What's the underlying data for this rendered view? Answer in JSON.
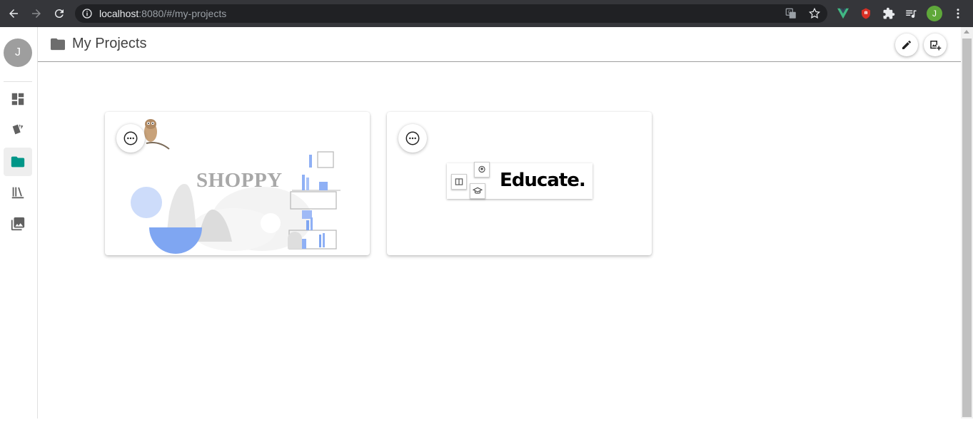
{
  "browser": {
    "url_host": "localhost",
    "url_rest": ":8080/#/my-projects",
    "profile_initial": "J"
  },
  "sidebar": {
    "avatar_initial": "J",
    "items": [
      {
        "icon": "dashboard-icon"
      },
      {
        "icon": "cards-icon"
      },
      {
        "icon": "folder-icon",
        "active": true
      },
      {
        "icon": "library-icon"
      },
      {
        "icon": "photo-library-icon"
      }
    ]
  },
  "header": {
    "title": "My Projects",
    "actions": [
      "edit-icon",
      "add-photo-icon"
    ]
  },
  "projects": [
    {
      "name": "SHOPPY"
    },
    {
      "name": "Educate."
    }
  ],
  "colors": {
    "accent": "#009688",
    "chrome_bg": "#35363a",
    "omnibox_bg": "#202124"
  }
}
